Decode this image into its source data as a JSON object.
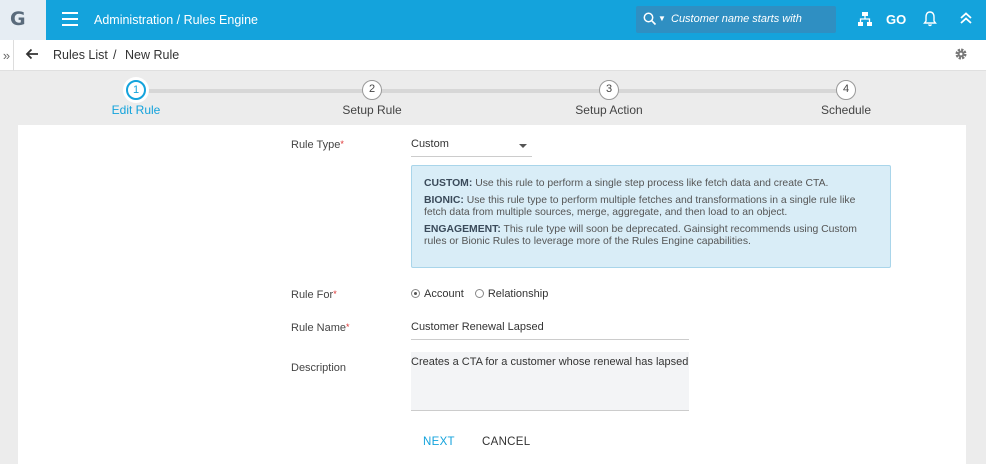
{
  "app": {
    "logo_letter": "G",
    "title": "Administration / Rules Engine"
  },
  "search": {
    "placeholder": "Customer name starts with"
  },
  "topbar": {
    "go_label": "GO"
  },
  "breadcrumb": {
    "expander": "»",
    "items": [
      "Rules List",
      "/",
      "New Rule"
    ]
  },
  "stepper": {
    "steps": [
      {
        "number": "1",
        "label": "Edit Rule",
        "active": true
      },
      {
        "number": "2",
        "label": "Setup Rule",
        "active": false
      },
      {
        "number": "3",
        "label": "Setup Action",
        "active": false
      },
      {
        "number": "4",
        "label": "Schedule",
        "active": false
      }
    ]
  },
  "form": {
    "rule_type": {
      "label": "Rule Type",
      "required_mark": "*",
      "value": "Custom"
    },
    "info": [
      {
        "title": "CUSTOM:",
        "text": "Use this rule to perform a single step process like fetch data and create CTA."
      },
      {
        "title": "BIONIC:",
        "text": "Use this rule type to perform multiple fetches and transformations in a single rule like fetch data from multiple sources, merge, aggregate, and then load to an object."
      },
      {
        "title": "ENGAGEMENT:",
        "text": "This rule type will soon be deprecated. Gainsight recommends using Custom rules or Bionic Rules to leverage more of the Rules Engine capabilities."
      }
    ],
    "rule_for": {
      "label": "Rule For",
      "required_mark": "*",
      "options": [
        "Account",
        "Relationship"
      ],
      "selected": "Account"
    },
    "rule_name": {
      "label": "Rule Name",
      "required_mark": "*",
      "value": "Customer Renewal Lapsed"
    },
    "description": {
      "label": "Description",
      "value": "Creates a CTA for a customer whose renewal has lapsed"
    }
  },
  "actions": {
    "next_label": "NEXT",
    "cancel_label": "CANCEL"
  },
  "colors": {
    "brand": "#14a3dc",
    "info_bg": "#d9edf7",
    "required": "#dd3333"
  }
}
